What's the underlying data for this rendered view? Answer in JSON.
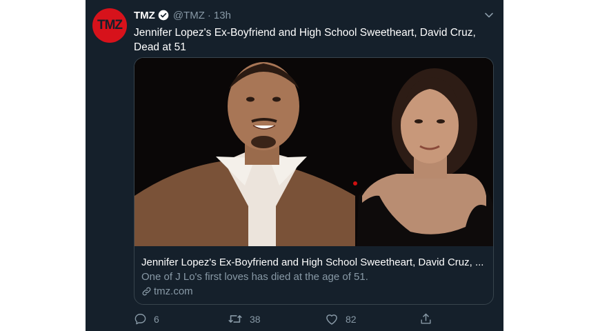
{
  "author": {
    "name": "TMZ",
    "handle": "@TMZ",
    "separator": "·",
    "time": "13h",
    "avatar_text": "TMZ"
  },
  "tweet": {
    "text": "Jennifer Lopez's Ex-Boyfriend and High School Sweetheart, David Cruz, Dead at 51"
  },
  "card": {
    "title": "Jennifer Lopez's Ex-Boyfriend and High School Sweetheart, David Cruz, ...",
    "description": "One of J Lo's first loves has died at the age of 51.",
    "domain": "tmz.com"
  },
  "actions": {
    "reply_count": "6",
    "retweet_count": "38",
    "like_count": "82"
  },
  "icons": {
    "verified": "verified-badge-icon",
    "caret": "chevron-down-icon",
    "link": "link-icon",
    "reply": "reply-icon",
    "retweet": "retweet-icon",
    "like": "heart-icon",
    "share": "share-icon"
  },
  "colors": {
    "background": "#15202b",
    "brand": "#d7121b",
    "muted": "#8899a6",
    "border": "#38444d"
  }
}
